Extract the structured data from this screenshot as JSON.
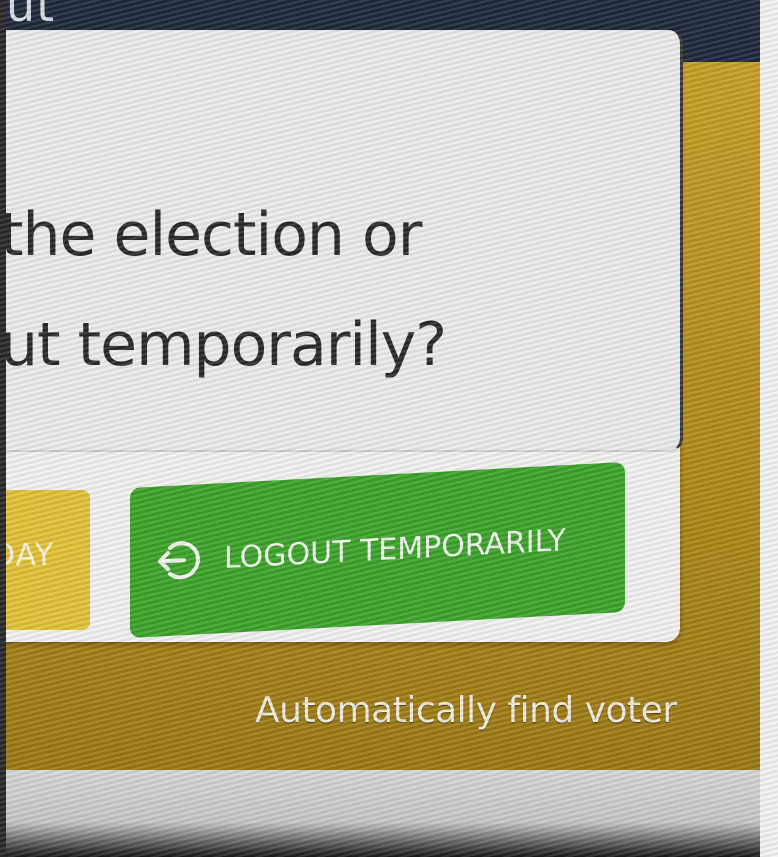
{
  "header": {
    "title_fragment": "ut"
  },
  "dialog": {
    "question_line1": "the election or",
    "question_line2": "ut temporarily?"
  },
  "buttons": {
    "today_label": "DAY",
    "logout_label": "LOGOUT TEMPORARILY",
    "logout_icon": "logout-icon"
  },
  "footer": {
    "auto_find_label": "Automatically find voter"
  },
  "colors": {
    "header_bg": "#1f2a3c",
    "gold_bg": "#c9a228",
    "dialog_bg": "#ebedee",
    "today_button": "#e3c33a",
    "logout_button": "#3ea52c"
  }
}
